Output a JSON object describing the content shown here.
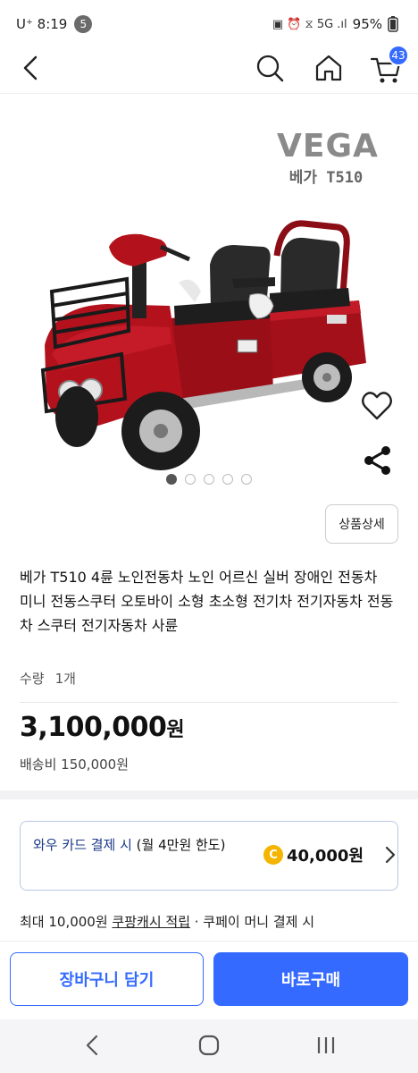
{
  "status_bar": {
    "carrier_time": "U⁺ 8:19",
    "notification_count": "5",
    "battery": "95%"
  },
  "header": {
    "cart_count": "43"
  },
  "product": {
    "brand_logo": "VEGA",
    "brand_model": "베가 T510",
    "image_count": 5,
    "active_image_index": 0,
    "detail_button_label": "상품상세",
    "title": "베가 T510 4륜 노인전동차 노인 어르신 실버 장애인 전동차 미니 전동스쿠터 오토바이 소형 초소형 전기차 전기자동차 전동차 스쿠터 전기자동차 사륜",
    "quantity_label": "수량",
    "quantity_value": "1개",
    "price_number": "3,100,000",
    "price_unit": "원",
    "shipping": "배송비 150,000원"
  },
  "card_promo": {
    "text": "와우 카드 결제 시 (월 4만원 한도)",
    "text_main": "와우 카드 결제 시",
    "text_sub": " (월 4만원 한도)",
    "coin_label": "C",
    "amount": "40,000원"
  },
  "cash_line": {
    "prefix": "최대 10,000원 ",
    "link": "쿠팡캐시 적립",
    "suffix": " · 쿠페이 머니 결제 시"
  },
  "actions": {
    "cart_label": "장바구니 담기",
    "buy_label": "바로구매"
  },
  "colors": {
    "accent": "#346aff",
    "coin": "#f4b400",
    "scooter_body": "#a3101a"
  }
}
